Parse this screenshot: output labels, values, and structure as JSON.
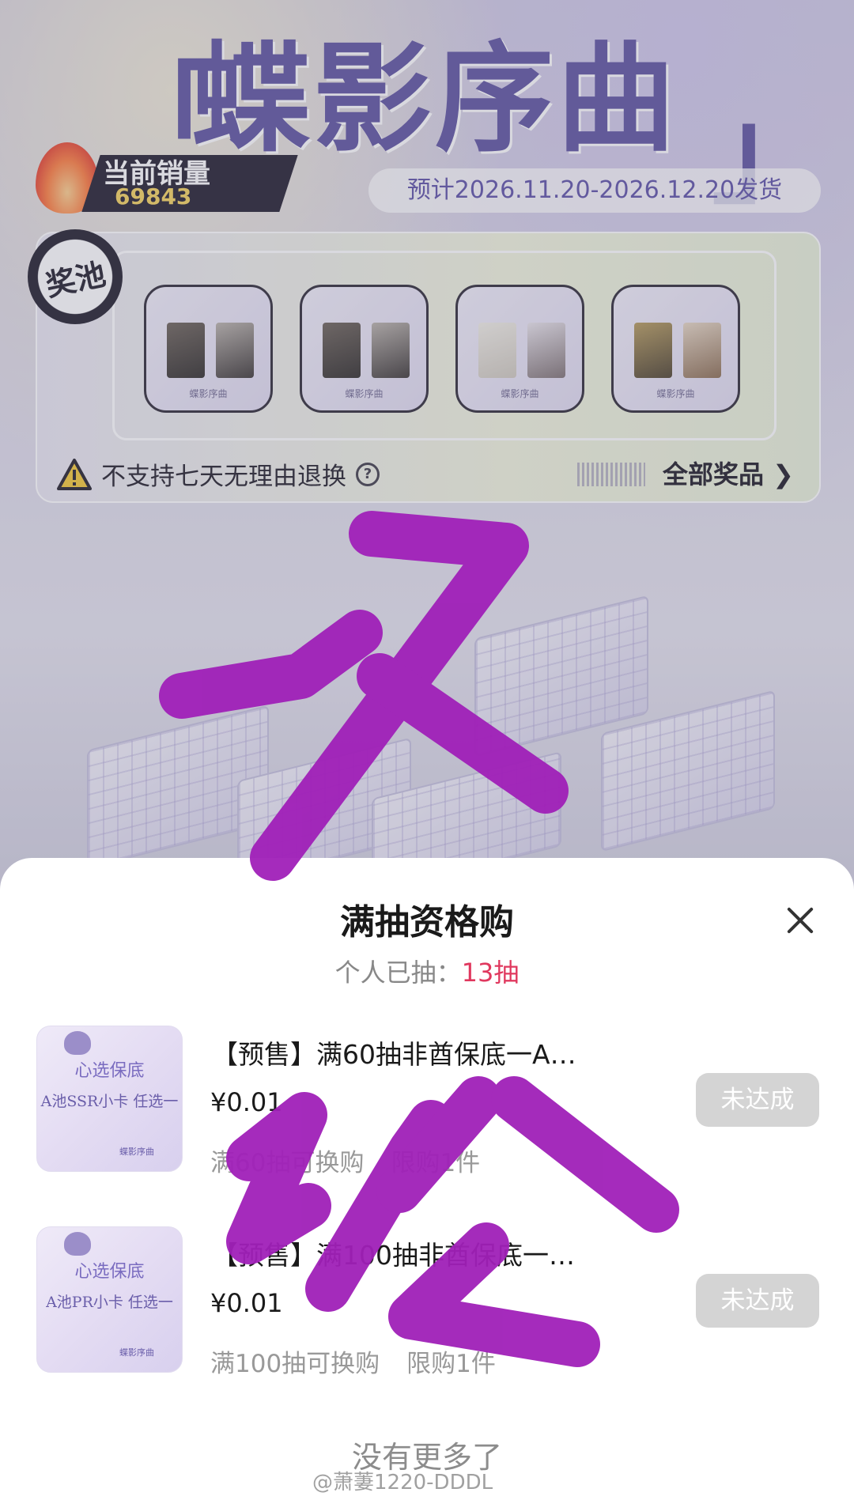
{
  "hero": {
    "title": "蝶影序曲",
    "bracket_open": "「",
    "bracket_close": "」",
    "sales_label": "当前销量",
    "sales_value": "69843",
    "ship_text": "预计2026.11.20-2026.12.20发货"
  },
  "pool": {
    "badge": "奖池",
    "card_caption": "蝶影序曲",
    "warning": "不支持七天无理由退换",
    "help_symbol": "?",
    "all_prizes": "全部奖品 ❯"
  },
  "sheet": {
    "title": "满抽资格购",
    "drawn_label": "个人已抽：",
    "drawn_count": "13抽",
    "items": [
      {
        "thumb_title": "心选保底",
        "thumb_body": "A池SSR小卡 任选一",
        "thumb_tag": "蝶影序曲",
        "title": "【预售】满60抽非酋保底一A…",
        "price": "¥0.01",
        "condition": "满60抽可换购",
        "limit": "限购1件",
        "status": "未达成"
      },
      {
        "thumb_title": "心选保底",
        "thumb_body": "A池PR小卡 任选一",
        "thumb_tag": "蝶影序曲",
        "title": "【预售】满100抽非酋保底一…",
        "price": "¥0.01",
        "condition": "满100抽可换购",
        "limit": "限购1件",
        "status": "未达成"
      }
    ],
    "no_more": "没有更多了"
  },
  "watermark": "@萧萋1220-DDDL",
  "colors": {
    "accent_count": "#e0385e",
    "status_disabled": "#d4d4d4",
    "scribble": "#a020b8"
  }
}
